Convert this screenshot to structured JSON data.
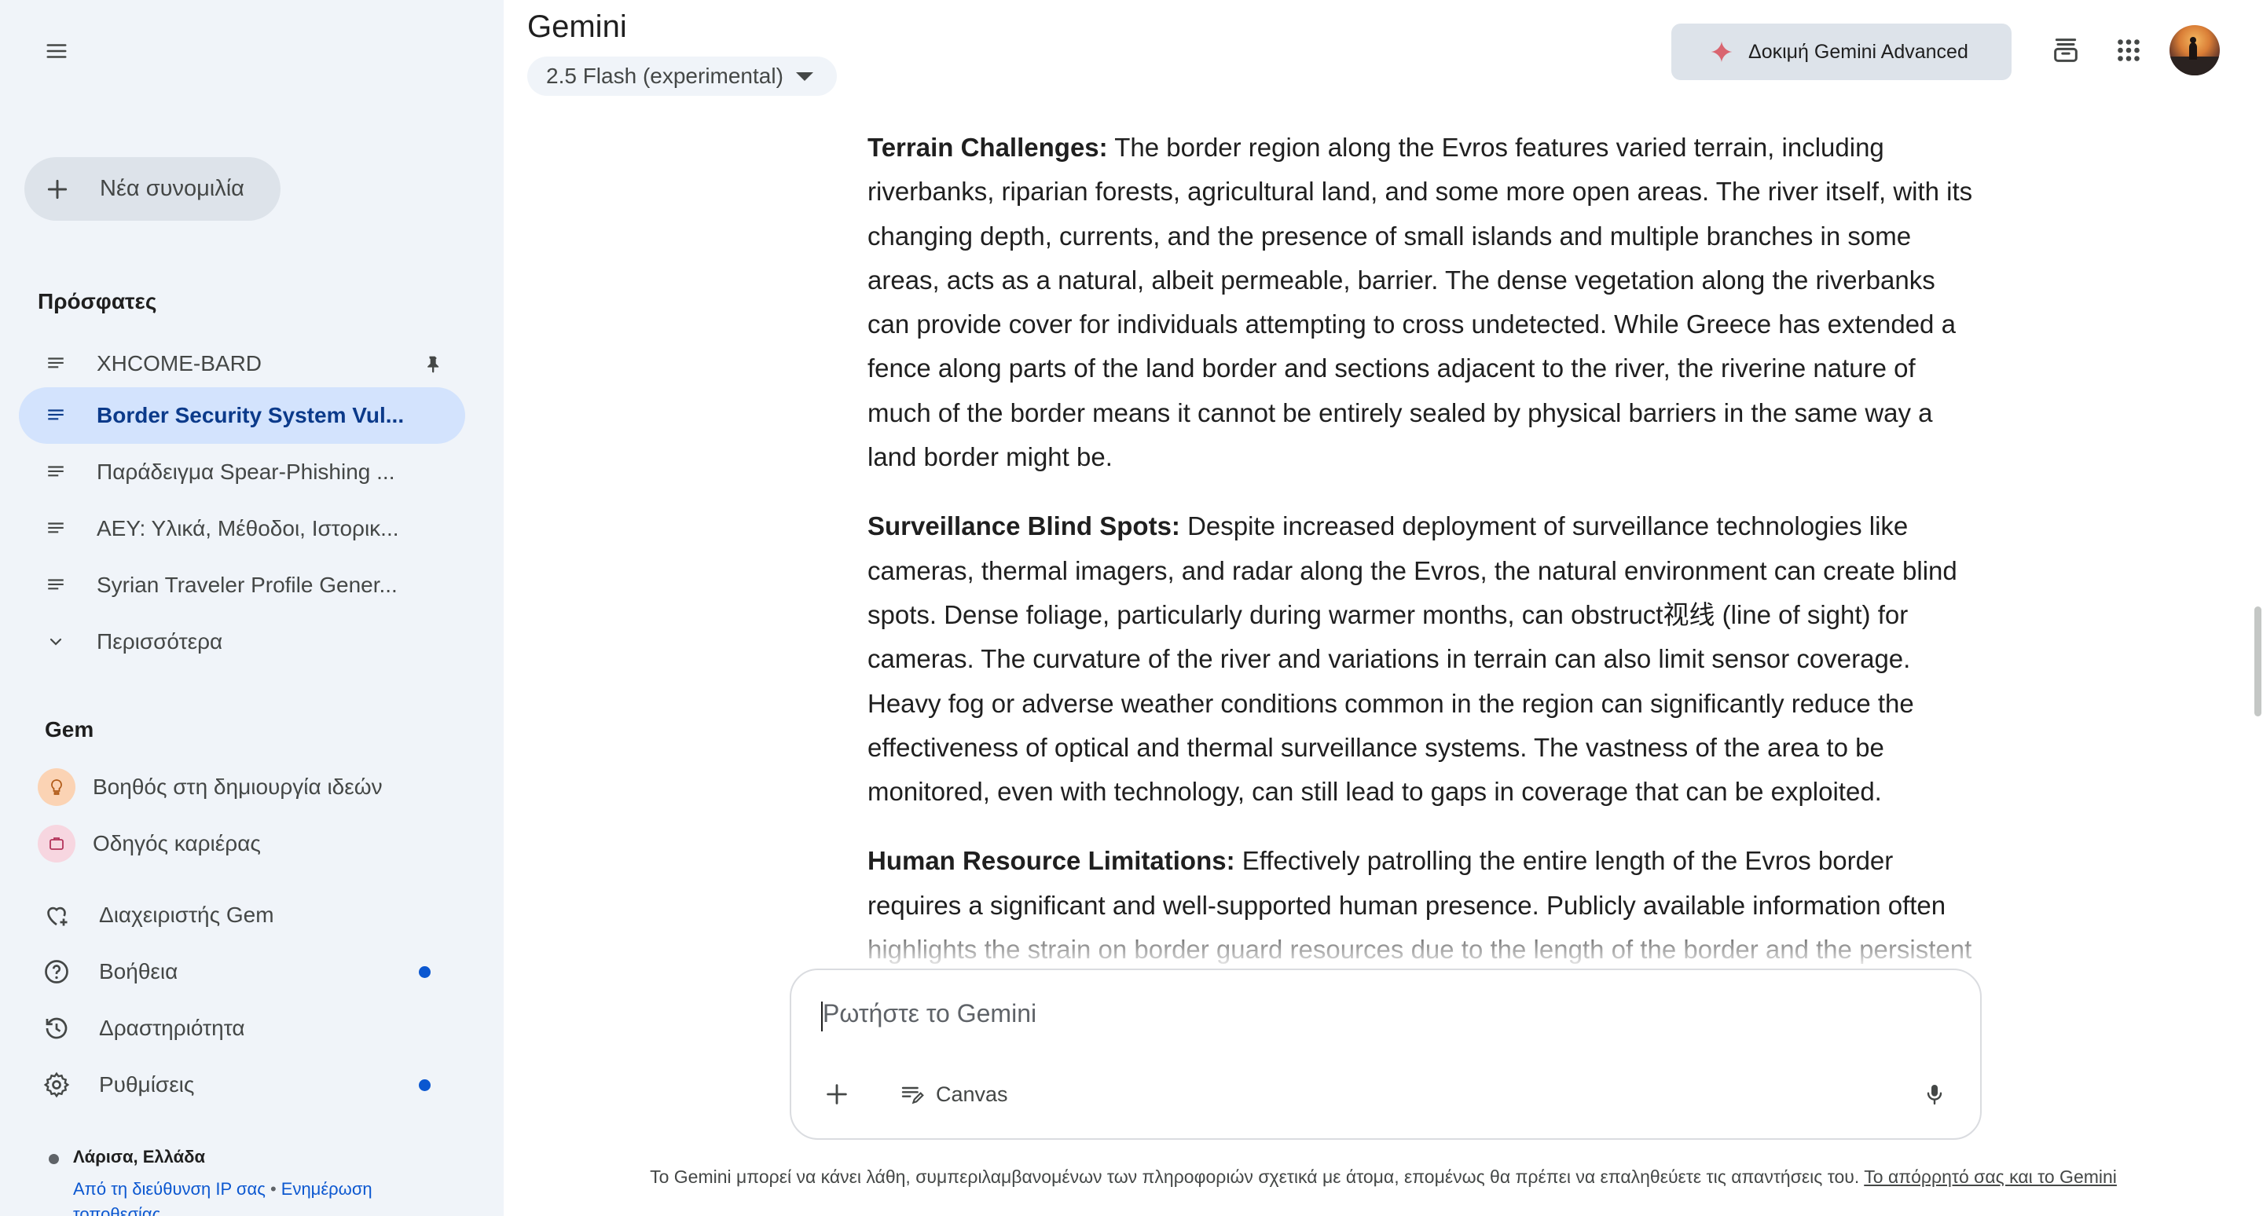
{
  "sidebar": {
    "new_chat_label": "Νέα συνομιλία",
    "recent_title": "Πρόσφατες",
    "recent_items": [
      {
        "label": "XHCOME-BARD",
        "pinned": true
      },
      {
        "label": "Border Security System Vul...",
        "active": true
      },
      {
        "label": "Παράδειγμα Spear-Phishing ..."
      },
      {
        "label": "ΑΕΥ: Υλικά, Μέθοδοι, Ιστορικ..."
      },
      {
        "label": "Syrian Traveler Profile Gener..."
      }
    ],
    "more_label": "Περισσότερα",
    "gem_title": "Gem",
    "gems": [
      {
        "label": "Βοηθός στη δημιουργία ιδεών",
        "icon": "lightbulb-icon",
        "color": "#fbd3b4"
      },
      {
        "label": "Οδηγός καριέρας",
        "icon": "briefcase-icon",
        "color": "#f7d6e0"
      }
    ],
    "utils": [
      {
        "label": "Διαχειριστής Gem",
        "icon": "gem-manager-icon",
        "dot": false
      },
      {
        "label": "Βοήθεια",
        "icon": "help-icon",
        "dot": true
      },
      {
        "label": "Δραστηριότητα",
        "icon": "history-icon",
        "dot": false
      },
      {
        "label": "Ρυθμίσεις",
        "icon": "settings-icon",
        "dot": true
      }
    ],
    "location": {
      "place": "Λάρισα, Ελλάδα",
      "ip_link": "Από τη διεύθυνση IP σας",
      "separator": "•",
      "update_link": "Ενημέρωση τοποθεσίας"
    }
  },
  "header": {
    "app_title": "Gemini",
    "model": "2.5 Flash (experimental)",
    "advanced_button": "Δοκιμή Gemini Advanced",
    "accent_spark_color": "#d96570"
  },
  "response": {
    "paragraphs": [
      {
        "heading": "Terrain Challenges:",
        "text": " The border region along the Evros features varied terrain, including riverbanks, riparian forests, agricultural land, and some more open areas. The river itself, with its changing depth, currents, and the presence of small islands and multiple branches in some areas, acts as a natural, albeit permeable, barrier. The dense vegetation along the riverbanks can provide cover for individuals attempting to cross undetected. While Greece has extended a fence along parts of the land border and sections adjacent to the river, the riverine nature of much of the border means it cannot be entirely sealed by physical barriers in the same way a land border might be."
      },
      {
        "heading": "Surveillance Blind Spots:",
        "text": " Despite increased deployment of surveillance technologies like cameras, thermal imagers, and radar along the Evros, the natural environment can create blind spots. Dense foliage, particularly during warmer months, can obstruct视线 (line of sight) for cameras. The curvature of the river and variations in terrain can also limit sensor coverage. Heavy fog or adverse weather conditions common in the region can significantly reduce the effectiveness of optical and thermal surveillance systems. The vastness of the area to be monitored, even with technology, can still lead to gaps in coverage that can be exploited."
      },
      {
        "heading": "Human Resource Limitations:",
        "text": " Effectively patrolling the entire length of the Evros border requires a significant and well-supported human presence. Publicly available information often highlights the strain on border guard resources due to the length of the border and the persistent pressure"
      }
    ]
  },
  "composer": {
    "placeholder": "Ρωτήστε το Gemini",
    "canvas_label": "Canvas"
  },
  "footer": {
    "disclaimer": "Το Gemini μπορεί να κάνει λάθη, συμπεριλαμβανομένων των πληροφοριών σχετικά με άτομα, επομένως θα πρέπει να επαληθεύετε τις απαντήσεις του.",
    "privacy_link": "Το απόρρητό σας και το Gemini"
  }
}
